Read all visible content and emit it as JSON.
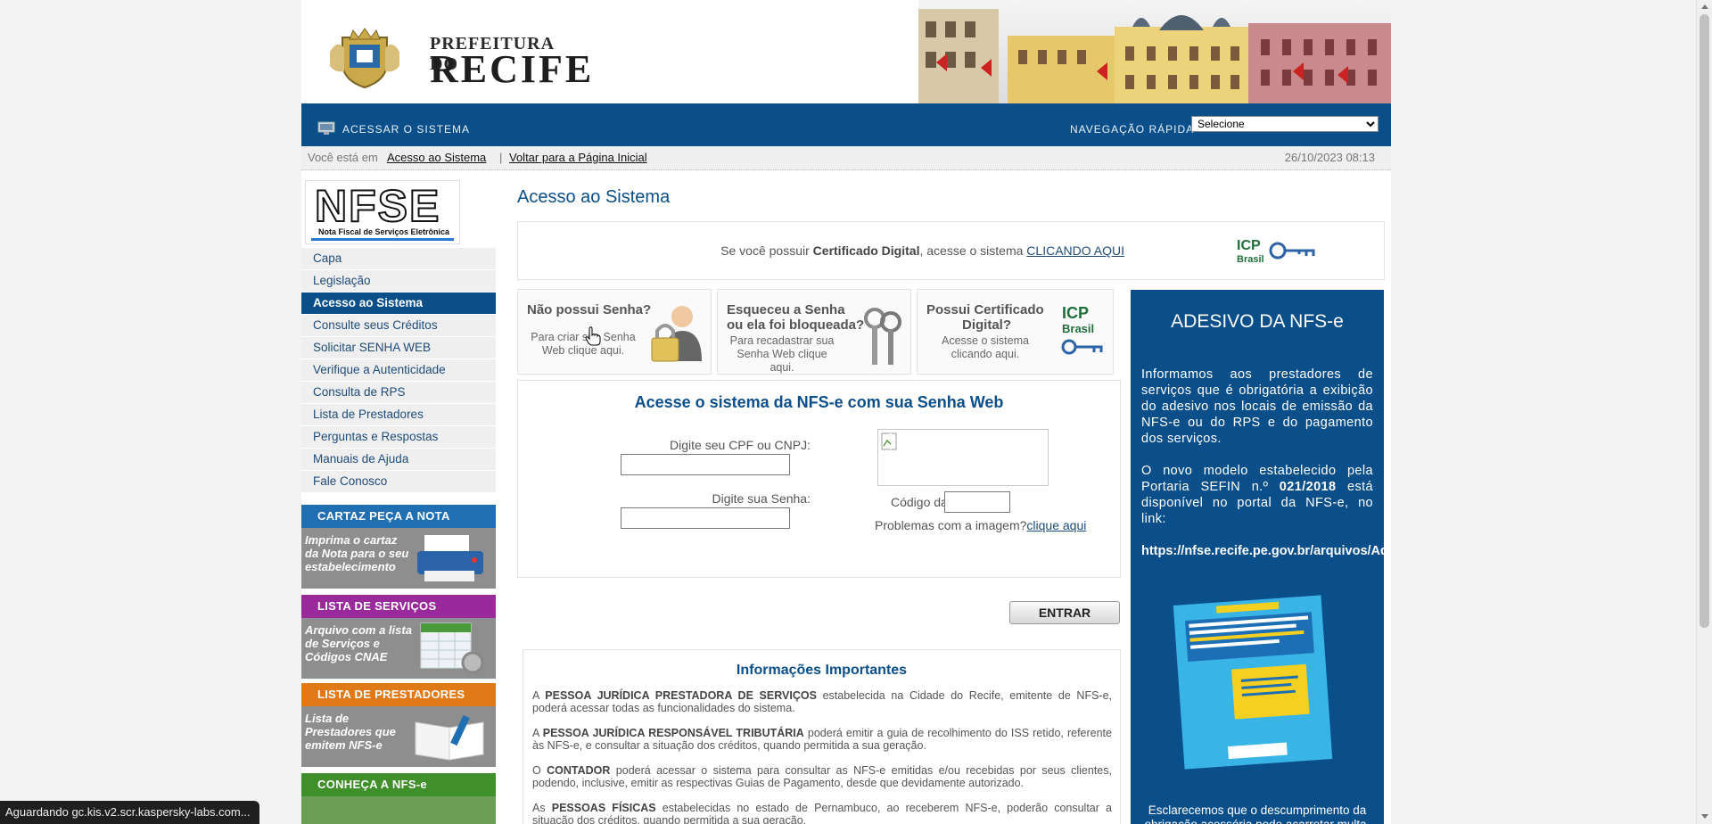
{
  "banner": {
    "logo_top": "PREFEITURA DO",
    "logo_main": "RECIFE"
  },
  "navbar": {
    "access_label": "ACESSAR O SISTEMA",
    "quick_nav_label": "NAVEGAÇÃO RÁPIDA",
    "quick_nav_value": "Selecione"
  },
  "breadcrumb": {
    "prefix": "Você está em",
    "link1": "Acesso ao Sistema",
    "separator": "|",
    "link2": "Voltar para a Página Inicial",
    "datetime": "26/10/2023 08:13"
  },
  "sidebar": {
    "logo_text": "NFSE",
    "logo_sub": "Nota Fiscal de Serviços Eletrônica",
    "items": [
      {
        "label": "Capa"
      },
      {
        "label": "Legislação"
      },
      {
        "label": "Acesso ao Sistema"
      },
      {
        "label": "Consulte seus Créditos"
      },
      {
        "label": "Solicitar SENHA WEB"
      },
      {
        "label": "Verifique a Autenticidade"
      },
      {
        "label": "Consulta de RPS"
      },
      {
        "label": "Lista de Prestadores"
      },
      {
        "label": "Perguntas e Respostas"
      },
      {
        "label": "Manuais de Ajuda"
      },
      {
        "label": "Fale Conosco"
      }
    ],
    "active_item": "Acesso ao Sistema",
    "promos": [
      {
        "title": "CARTAZ PEÇA A NOTA",
        "text": "Imprima o cartaz da Nota para o seu estabelecimento",
        "color": "#1f6fb2"
      },
      {
        "title": "LISTA DE SERVIÇOS",
        "text": "Arquivo com a lista de Serviços e Códigos CNAE",
        "color": "#9a2a9b"
      },
      {
        "title": "LISTA DE PRESTADORES",
        "text": "Lista de Prestadores que emitem NFS-e",
        "color": "#e07a16"
      },
      {
        "title": "CONHEÇA A NFS-e",
        "text": "",
        "color": "#3f8f2a"
      }
    ]
  },
  "main": {
    "title": "Acesso ao Sistema",
    "cert": {
      "text_before": "Se você possuir",
      "text_bold": "Certificado Digital",
      "text_after": ", acesse o sistema",
      "link": "CLICANDO AQUI"
    },
    "icp_logo": {
      "line1": "ICP",
      "line2": "Brasil"
    },
    "options": [
      {
        "title_line1": "Não possui Senha?",
        "title_line2": "",
        "sub_line1": "Para criar sua Senha",
        "sub_line2": "Web clique aqui.",
        "icon": "user-padlock-icon"
      },
      {
        "title_line1": "Esqueceu a Senha",
        "title_line2": "ou ela foi bloqueada?",
        "sub_line1": "Para recadastrar sua",
        "sub_line2": "Senha Web clique aqui.",
        "icon": "keys-icon"
      },
      {
        "title_line1": "Possui Certificado",
        "title_line2": "Digital?",
        "sub_line1": "Acesse o sistema",
        "sub_line2": "clicando aqui.",
        "icon": "icp-brasil-icon"
      }
    ],
    "login": {
      "title": "Acesse o sistema da NFS-e com sua Senha Web",
      "cpf_label": "Digite seu CPF ou CNPJ:",
      "password_label": "Digite sua Senha:",
      "captcha_label": "Código da Imagem:",
      "captcha_help": "Problemas com a imagem?",
      "captcha_help_link": "clique aqui",
      "submit": "ENTRAR"
    },
    "info": {
      "title": "Informações Importantes",
      "paragraphs": [
        {
          "pre": "A ",
          "bold": "PESSOA JURÍDICA PRESTADORA DE SERVIÇOS",
          "post": " estabelecida na Cidade do Recife, emitente de NFS-e, poderá acessar todas as funcionalidades do sistema."
        },
        {
          "pre": "A ",
          "bold": "PESSOA JURÍDICA RESPONSÁVEL TRIBUTÁRIA",
          "post": " poderá emitir a guia de recolhimento do ISS retido, referente às NFS-e, e consultar a situação dos créditos, quando permitida a sua geração."
        },
        {
          "pre": "O ",
          "bold": "CONTADOR",
          "post": " poderá acessar o sistema para consultar as NFS-e emitidas e/ou recebidas por seus clientes, podendo, inclusive, emitir as respectivas Guias de Pagamento, desde que devidamente autorizado."
        },
        {
          "pre": "As ",
          "bold": "PESSOAS FÍSICAS",
          "post": " estabelecidas no estado de Pernambuco, ao receberem NFS-e, poderão consultar a situação dos créditos, quando permitida a sua geração."
        }
      ]
    }
  },
  "sticker": {
    "title": "ADESIVO DA NFS-e",
    "p1": "Informamos aos prestadores de serviços que é obrigatória a exibição do adesivo nos locais de emissão da NFS-e ou do RPS e do pagamento dos serviços.",
    "p2_pre": "O novo modelo estabelecido pela Portaria SEFIN n.º ",
    "p2_bold": "021/2018",
    "p2_post": " está disponível no portal da NFS-e, no link:",
    "url": "https://nfse.recife.pe.gov.br/arquivos/AdesivoRecife.pdf.",
    "foot": "Esclarecemos que o descumprimento da obrigação acessória pode acarretar multa."
  },
  "status": {
    "text": "Aguardando gc.kis.v2.scr.kaspersky-labs.com..."
  },
  "colors": {
    "primary": "#0b4f8a",
    "link": "#1f4c7a",
    "panel_bg": "#efefef"
  }
}
